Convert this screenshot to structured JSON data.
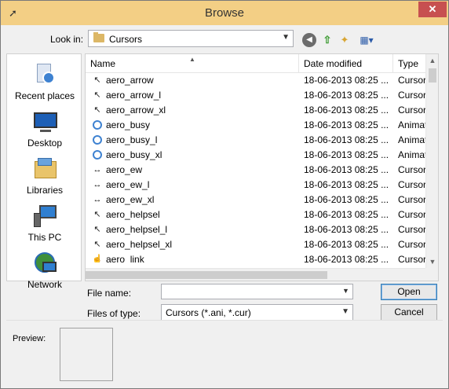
{
  "window": {
    "title": "Browse",
    "close_glyph": "✕",
    "title_icon": "mouse-pointer-icon"
  },
  "lookin": {
    "label": "Look in:",
    "value": "Cursors"
  },
  "toolbar": {
    "back_icon": "back-arrow-icon",
    "up_icon": "up-folder-icon",
    "new_folder_icon": "new-folder-icon",
    "view_menu_icon": "view-menu-icon"
  },
  "places": [
    {
      "label": "Recent places",
      "icon": "recent-places-icon"
    },
    {
      "label": "Desktop",
      "icon": "desktop-icon"
    },
    {
      "label": "Libraries",
      "icon": "libraries-icon"
    },
    {
      "label": "This PC",
      "icon": "this-pc-icon"
    },
    {
      "label": "Network",
      "icon": "network-icon"
    }
  ],
  "columns": {
    "name": "Name",
    "date": "Date modified",
    "type": "Type"
  },
  "files": [
    {
      "name": "aero_arrow",
      "date": "18-06-2013 08:25 ...",
      "type": "Cursor",
      "icon": "arrow-cursor-icon",
      "glyph": "↖"
    },
    {
      "name": "aero_arrow_l",
      "date": "18-06-2013 08:25 ...",
      "type": "Cursor",
      "icon": "arrow-cursor-icon",
      "glyph": "↖"
    },
    {
      "name": "aero_arrow_xl",
      "date": "18-06-2013 08:25 ...",
      "type": "Cursor",
      "icon": "arrow-cursor-icon",
      "glyph": "↖"
    },
    {
      "name": "aero_busy",
      "date": "18-06-2013 08:25 ...",
      "type": "Animated cursor",
      "icon": "busy-ring-icon",
      "glyph": ""
    },
    {
      "name": "aero_busy_l",
      "date": "18-06-2013 08:25 ...",
      "type": "Animated cursor",
      "icon": "busy-ring-icon",
      "glyph": ""
    },
    {
      "name": "aero_busy_xl",
      "date": "18-06-2013 08:25 ...",
      "type": "Animated cursor",
      "icon": "busy-ring-icon",
      "glyph": ""
    },
    {
      "name": "aero_ew",
      "date": "18-06-2013 08:25 ...",
      "type": "Cursor",
      "icon": "resize-ew-icon",
      "glyph": "↔"
    },
    {
      "name": "aero_ew_l",
      "date": "18-06-2013 08:25 ...",
      "type": "Cursor",
      "icon": "resize-ew-icon",
      "glyph": "↔"
    },
    {
      "name": "aero_ew_xl",
      "date": "18-06-2013 08:25 ...",
      "type": "Cursor",
      "icon": "resize-ew-icon",
      "glyph": "↔"
    },
    {
      "name": "aero_helpsel",
      "date": "18-06-2013 08:25 ...",
      "type": "Cursor",
      "icon": "help-cursor-icon",
      "glyph": "↖"
    },
    {
      "name": "aero_helpsel_l",
      "date": "18-06-2013 08:25 ...",
      "type": "Cursor",
      "icon": "help-cursor-icon",
      "glyph": "↖"
    },
    {
      "name": "aero_helpsel_xl",
      "date": "18-06-2013 08:25 ...",
      "type": "Cursor",
      "icon": "help-cursor-icon",
      "glyph": "↖"
    },
    {
      "name": "aero_link",
      "date": "18-06-2013 08:25 ...",
      "type": "Cursor",
      "icon": "hand-cursor-icon",
      "glyph": "☝"
    }
  ],
  "form": {
    "filename_label": "File name:",
    "filename_value": "",
    "filetype_label": "Files of type:",
    "filetype_value": "Cursors (*.ani, *.cur)"
  },
  "buttons": {
    "open": "Open",
    "cancel": "Cancel"
  },
  "preview": {
    "label": "Preview:"
  },
  "colors": {
    "titlebar": "#f3cf85",
    "close": "#c75050",
    "accent": "#3e82d1"
  }
}
